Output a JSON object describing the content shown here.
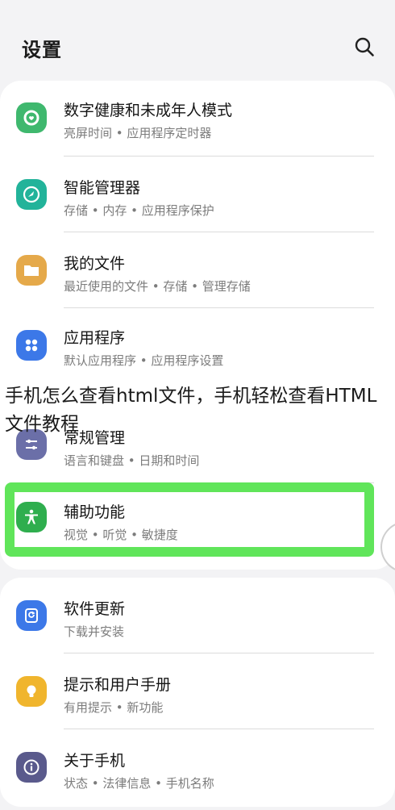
{
  "header": {
    "title": "设置",
    "search_icon": "search-icon"
  },
  "groups": [
    {
      "items": [
        {
          "title": "数字健康和未成年人模式",
          "subtitle": "亮屏时间 • 应用程序定时器",
          "icon": "digital-wellbeing-icon",
          "icon_color": "#3fb86e"
        },
        {
          "title": "智能管理器",
          "subtitle": "存储 • 内存 • 应用程序保护",
          "icon": "device-care-icon",
          "icon_color": "#22b39a"
        },
        {
          "title": "我的文件",
          "subtitle": "最近使用的文件 • 存储 • 管理存储",
          "icon": "folder-icon",
          "icon_color": "#e5a94a"
        },
        {
          "title": "应用程序",
          "subtitle": "默认应用程序 • 应用程序设置",
          "icon": "apps-icon",
          "icon_color": "#3c78e8"
        },
        {
          "title": "常规管理",
          "subtitle": "语言和键盘 • 日期和时间",
          "icon": "sliders-icon",
          "icon_color": "#6b6fa8"
        },
        {
          "title": "辅助功能",
          "subtitle": "视觉 • 听觉 • 敏捷度",
          "icon": "accessibility-icon",
          "icon_color": "#2fae4e"
        }
      ]
    },
    {
      "items": [
        {
          "title": "软件更新",
          "subtitle": "下载并安装",
          "icon": "update-icon",
          "icon_color": "#3c78e8"
        },
        {
          "title": "提示和用户手册",
          "subtitle": "有用提示 • 新功能",
          "icon": "lightbulb-icon",
          "icon_color": "#f0b52d"
        },
        {
          "title": "关于手机",
          "subtitle": "状态 • 法律信息 • 手机名称",
          "icon": "info-icon",
          "icon_color": "#5a5a8c"
        }
      ]
    }
  ],
  "overlay": {
    "caption": "手机怎么查看html文件，手机轻松查看HTML文件教程",
    "highlight_color": "#57e451"
  }
}
